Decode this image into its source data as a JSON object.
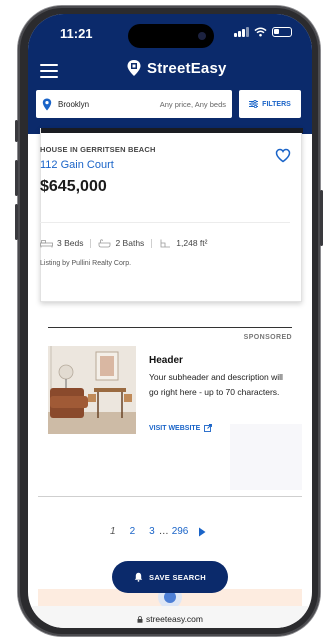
{
  "status_bar": {
    "time": "11:21"
  },
  "header": {
    "logo_text": "StreetEasy"
  },
  "search": {
    "location": "Brooklyn",
    "filter_summary": "Any price, Any beds",
    "filters_label": "FILTERS"
  },
  "listing": {
    "type_label": "HOUSE IN GERRITSEN BEACH",
    "address": "112 Gain Court",
    "price": "$645,000",
    "beds": "3 Beds",
    "baths": "2 Baths",
    "area": "1,248 ft²",
    "listed_by": "Listing by Pullini Realty Corp."
  },
  "ad": {
    "sponsored_label": "SPONSORED",
    "header": "Header",
    "description": "Your subheader and description will go right here - up to 70 characters.",
    "link_label": "VISIT WEBSITE"
  },
  "pagination": {
    "pages": [
      "1",
      "2",
      "3"
    ],
    "ellipsis": "…",
    "last_page": "296",
    "current": "1"
  },
  "save_search": {
    "label": "SAVE SEARCH"
  },
  "browser": {
    "url": "streeteasy.com"
  },
  "colors": {
    "navy": "#0b2a6b",
    "link_blue": "#1a64c8",
    "peach": "#fdece0"
  }
}
